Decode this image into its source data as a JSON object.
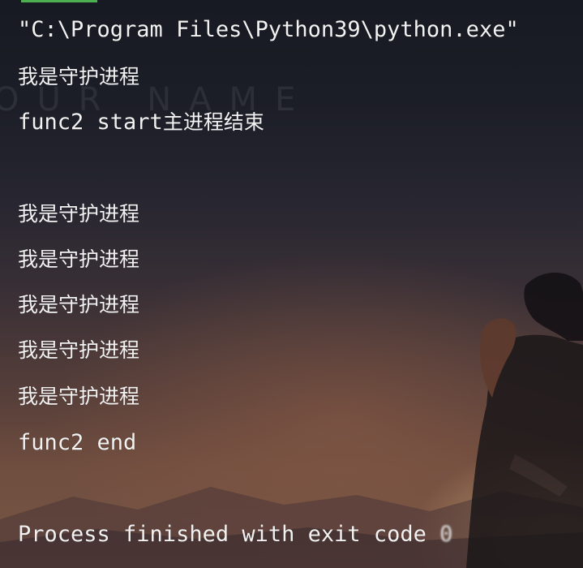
{
  "console": {
    "lines": [
      "\"C:\\Program Files\\Python39\\python.exe\"",
      "我是守护进程",
      "func2 start",
      "主进程结束",
      "我是守护进程",
      "我是守护进程",
      "我是守护进程",
      "我是守护进程",
      "我是守护进程",
      "func2 end",
      "Process finished with exit code ",
      "0"
    ],
    "watermark": "OUR NAME"
  },
  "colors": {
    "text": "#f2f2f2",
    "tab_indicator": "#4caf50",
    "background_top": "#171a22",
    "background_bottom": "#7a5846"
  }
}
